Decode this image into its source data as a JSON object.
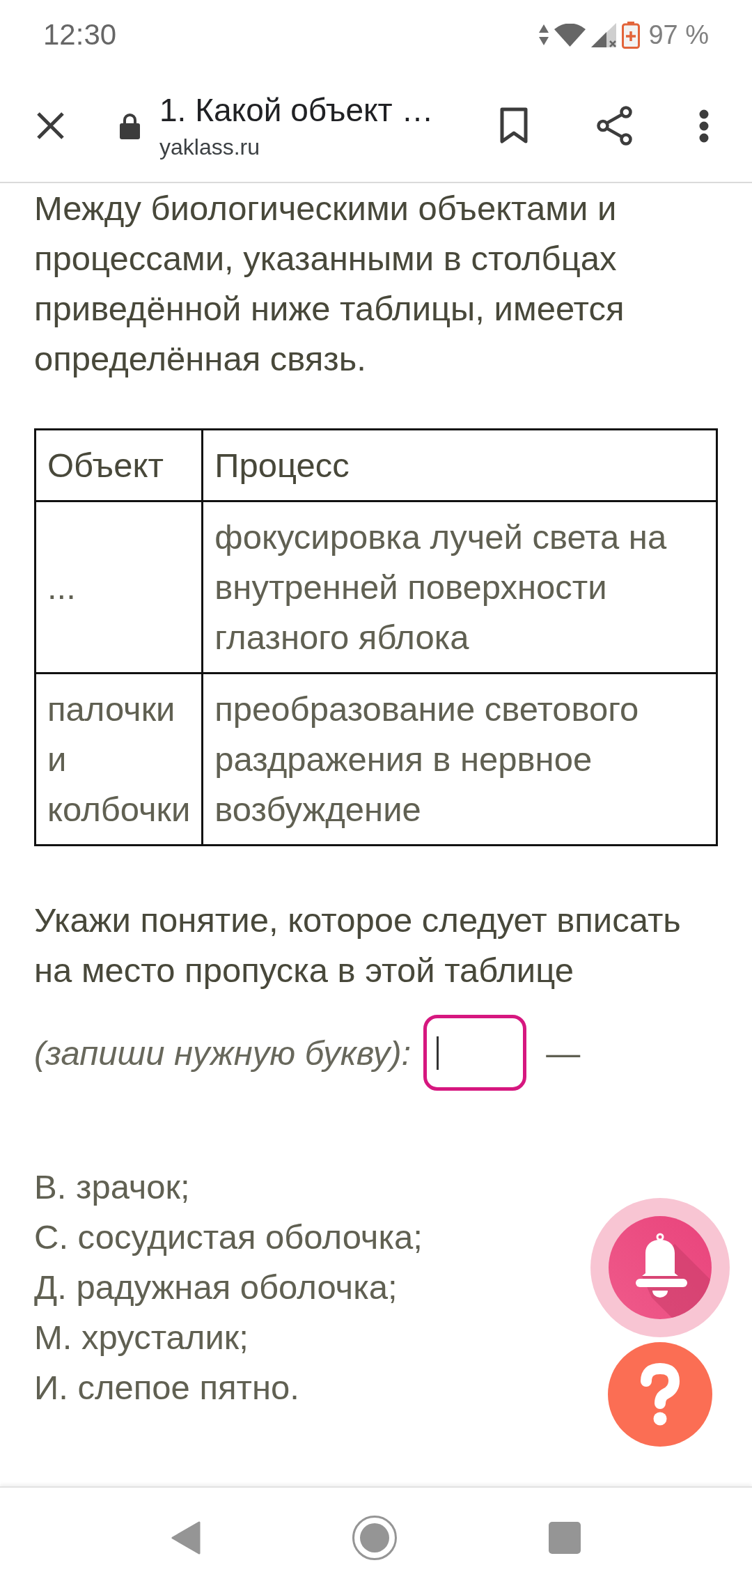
{
  "status_bar": {
    "time": "12:30",
    "battery": "97 %"
  },
  "browser_bar": {
    "title": "1. Какой объект …",
    "url": "yaklass.ru"
  },
  "intro": "Между биологическими объектами и процессами, указанными в столбцах приведённой ниже таблицы, имеется определённая связь.",
  "table": {
    "columns": [
      "Объект",
      "Процесс"
    ],
    "rows": [
      [
        "...",
        "фокусировка лучей света на внутренней поверхности глазного яблока"
      ],
      [
        "палочки и колбочки",
        "преобразование светового раздражения в нервное возбуждение"
      ]
    ]
  },
  "question": {
    "text": "Укажи понятие, которое следует вписать на место пропуска в этой таблице",
    "hint": "(запиши нужную букву):",
    "answer_field": {
      "focused": true
    },
    "dash": "—"
  },
  "options": [
    "В. зрачок;",
    "С. сосудистая оболочка;",
    "Д. радужная оболочка;",
    "М. хрусталик;",
    "И. слепое пятно."
  ]
}
